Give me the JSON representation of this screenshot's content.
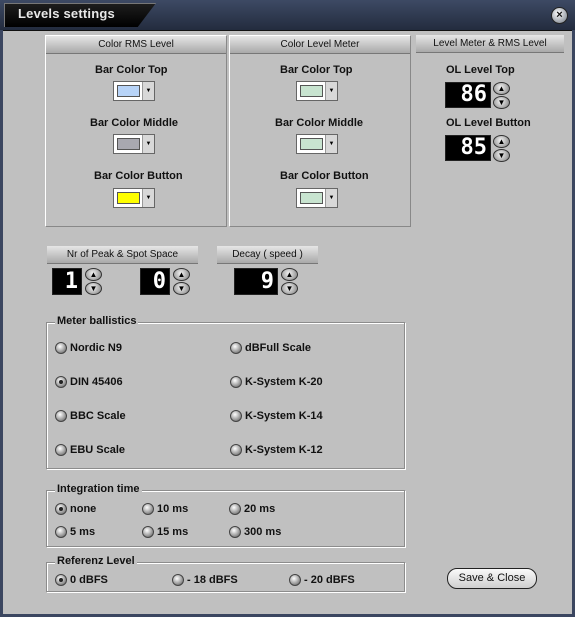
{
  "window": {
    "title": "Levels settings",
    "close_glyph": "×"
  },
  "rms_panel": {
    "header": "Color RMS Level",
    "items": [
      {
        "label": "Bar Color Top",
        "color": "#b8d4f8"
      },
      {
        "label": "Bar Color Middle",
        "color": "#a8a8b0"
      },
      {
        "label": "Bar Color Button",
        "color": "#ffff00"
      }
    ]
  },
  "meter_panel": {
    "header": "Color Level Meter",
    "items": [
      {
        "label": "Bar Color Top",
        "color": "#c8e4d0"
      },
      {
        "label": "Bar Color Middle",
        "color": "#c8e4d0"
      },
      {
        "label": "Bar Color Button",
        "color": "#c8e4d0"
      }
    ]
  },
  "ol_panel": {
    "header": "Level Meter & RMS Level",
    "top_label": "OL Level Top",
    "top_value": "86",
    "button_label": "OL Level Button",
    "button_value": "85"
  },
  "peak": {
    "header": "Nr of Peak  & Spot Space",
    "peak_value": "1",
    "spot_value": "0"
  },
  "decay": {
    "header": "Decay ( speed )",
    "value": "9"
  },
  "ballistics": {
    "title": "Meter ballistics",
    "options": [
      {
        "label": "Nordic N9",
        "selected": false
      },
      {
        "label": "dBFull Scale",
        "selected": false
      },
      {
        "label": "DIN 45406",
        "selected": true
      },
      {
        "label": "K-System K-20",
        "selected": false
      },
      {
        "label": "BBC Scale",
        "selected": false
      },
      {
        "label": "K-System K-14",
        "selected": false
      },
      {
        "label": "EBU Scale",
        "selected": false
      },
      {
        "label": "K-System K-12",
        "selected": false
      }
    ]
  },
  "integration": {
    "title": "Integration time",
    "options": [
      {
        "label": "none",
        "selected": true
      },
      {
        "label": "10 ms",
        "selected": false
      },
      {
        "label": "20 ms",
        "selected": false
      },
      {
        "label": "5 ms",
        "selected": false
      },
      {
        "label": "15 ms",
        "selected": false
      },
      {
        "label": "300 ms",
        "selected": false
      }
    ]
  },
  "reference": {
    "title": "Referenz Level",
    "options": [
      {
        "label": "0 dBFS",
        "selected": true
      },
      {
        "label": "- 18 dBFS",
        "selected": false
      },
      {
        "label": "- 20 dBFS",
        "selected": false
      }
    ]
  },
  "save_label": "Save & Close",
  "icons": {
    "spin_up": "▲",
    "spin_down": "▼",
    "dropdown": "▼"
  }
}
